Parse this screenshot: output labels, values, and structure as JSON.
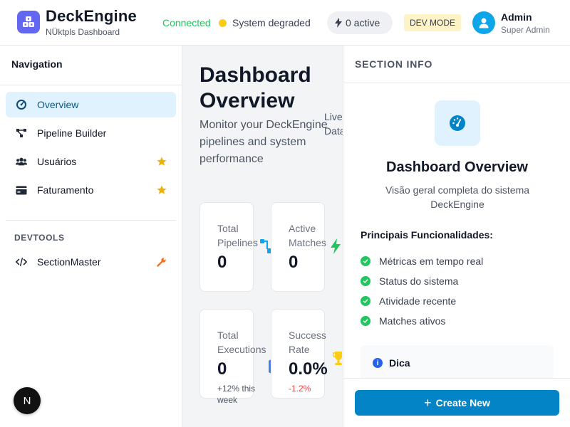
{
  "header": {
    "brand_title": "DeckEngine",
    "brand_subtitle": "NÜktpls Dashboard",
    "connection_status": "Connected",
    "system_status": "System degraded",
    "active_count": "0 active",
    "dev_mode_badge": "DEV MODE",
    "user_name": "Admin",
    "user_role": "Super Admin",
    "colors": {
      "connected": "#22c55e",
      "degraded_dot": "#facc15",
      "brand_logo": "#6366f1"
    }
  },
  "sidebar": {
    "title": "Navigation",
    "items": [
      {
        "label": "Overview",
        "icon": "gauge-icon",
        "active": true
      },
      {
        "label": "Pipeline Builder",
        "icon": "flow-icon"
      },
      {
        "label": "Usuários",
        "icon": "users-icon",
        "badge_icon": "star-icon"
      },
      {
        "label": "Faturamento",
        "icon": "credit-card-icon",
        "badge_icon": "star-icon"
      }
    ],
    "devtools_title": "DEVTOOLS",
    "devtools_items": [
      {
        "label": "SectionMaster",
        "icon": "code-icon",
        "badge_icon": "wrench-icon"
      }
    ],
    "fab_label": "N"
  },
  "main": {
    "title": "Dashboard Overview",
    "description": "Monitor your DeckEngine pipelines and system performance",
    "live_text_line1": "Live",
    "live_text_line2": "Data",
    "cards": [
      {
        "label": "Total Pipelines",
        "label_line1": "Total",
        "label_line2": "Pipelines",
        "value": "0",
        "icon": "flow-icon"
      },
      {
        "label": "Active Matches",
        "label_line1": "Active",
        "label_line2": "Matches",
        "value": "0",
        "icon": "bolt-icon"
      },
      {
        "label": "Total Executions",
        "label_line1": "Total",
        "label_line2": "Executions",
        "value": "0",
        "sub_line1": "+12% this",
        "sub_line2": "week",
        "icon": "activity-icon"
      },
      {
        "label": "Success Rate",
        "label_line1": "Success",
        "label_line2": "Rate",
        "value": "0.0%",
        "sub": "-1.2%",
        "icon": "trophy-icon"
      }
    ]
  },
  "panel": {
    "header": "SECTION INFO",
    "icon": "gauge-icon",
    "title": "Dashboard Overview",
    "description": "Visão geral completa do sistema DeckEngine",
    "features_title": "Principais Funcionalidades:",
    "features": [
      "Métricas em tempo real",
      "Status do sistema",
      "Atividade recente",
      "Matches ativos"
    ],
    "tip_title": "Dica",
    "create_button": "Create New",
    "colors": {
      "primary": "#0284c7",
      "check": "#22c55e"
    }
  }
}
